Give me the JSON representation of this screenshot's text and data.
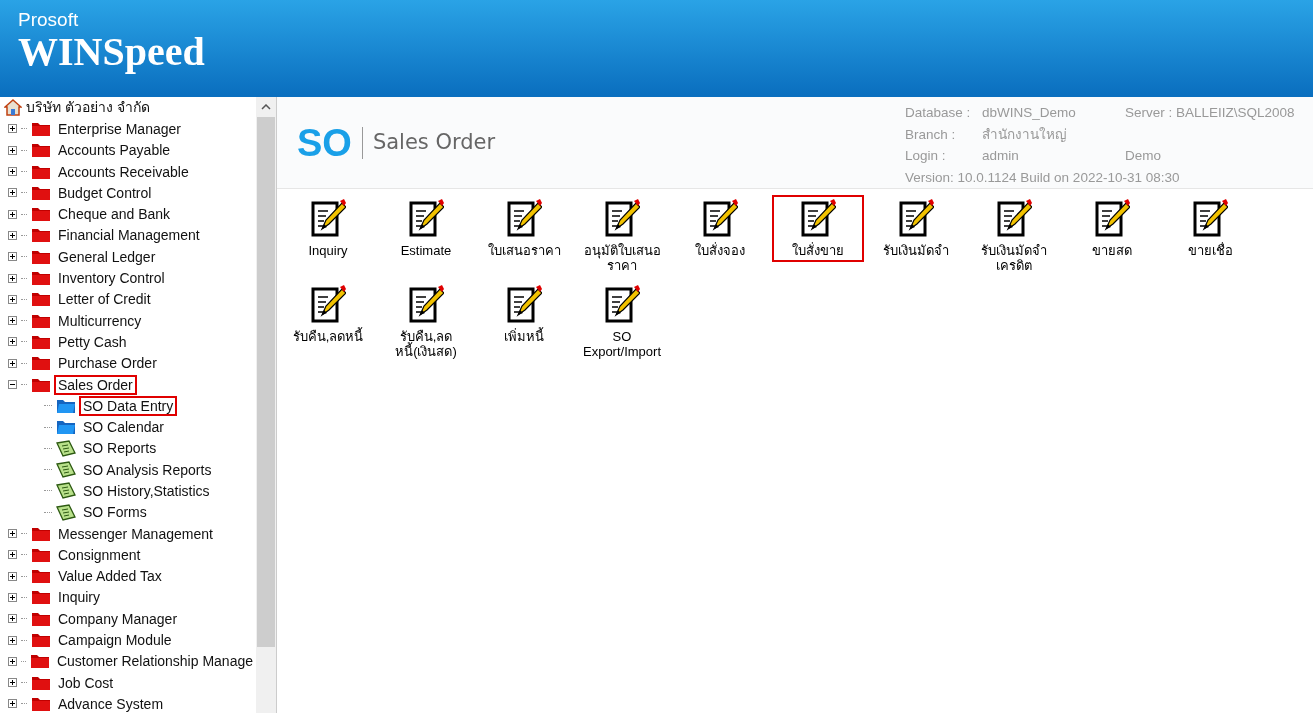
{
  "header": {
    "brand_top": "Prosoft",
    "brand_main": "WINSpeed"
  },
  "tree": {
    "label": "บริษัท ตัวอย่าง จำกัด",
    "children": [
      {
        "label": "Enterprise Manager",
        "kind": "folder",
        "expanded": false,
        "highlighted": false
      },
      {
        "label": "Accounts Payable",
        "kind": "folder",
        "expanded": false,
        "highlighted": false
      },
      {
        "label": "Accounts Receivable",
        "kind": "folder",
        "expanded": false,
        "highlighted": false
      },
      {
        "label": "Budget Control",
        "kind": "folder",
        "expanded": false,
        "highlighted": false
      },
      {
        "label": "Cheque and Bank",
        "kind": "folder",
        "expanded": false,
        "highlighted": false
      },
      {
        "label": "Financial Management",
        "kind": "folder",
        "expanded": false,
        "highlighted": false
      },
      {
        "label": "General Ledger",
        "kind": "folder",
        "expanded": false,
        "highlighted": false
      },
      {
        "label": "Inventory Control",
        "kind": "folder",
        "expanded": false,
        "highlighted": false
      },
      {
        "label": "Letter of Credit",
        "kind": "folder",
        "expanded": false,
        "highlighted": false
      },
      {
        "label": "Multicurrency",
        "kind": "folder",
        "expanded": false,
        "highlighted": false
      },
      {
        "label": "Petty Cash",
        "kind": "folder",
        "expanded": false,
        "highlighted": false
      },
      {
        "label": "Purchase Order",
        "kind": "folder",
        "expanded": false,
        "highlighted": false
      },
      {
        "label": "Sales Order",
        "kind": "folder",
        "expanded": true,
        "highlighted": true,
        "children": [
          {
            "label": "SO Data Entry",
            "kind": "entry",
            "highlighted": true
          },
          {
            "label": "SO Calendar",
            "kind": "entry",
            "highlighted": false
          },
          {
            "label": "SO Reports",
            "kind": "report",
            "highlighted": false
          },
          {
            "label": "SO Analysis Reports",
            "kind": "report",
            "highlighted": false
          },
          {
            "label": "SO History,Statistics",
            "kind": "report",
            "highlighted": false
          },
          {
            "label": "SO Forms",
            "kind": "report",
            "highlighted": false
          }
        ]
      },
      {
        "label": "Messenger Management",
        "kind": "folder",
        "expanded": false,
        "highlighted": false
      },
      {
        "label": "Consignment",
        "kind": "folder",
        "expanded": false,
        "highlighted": false
      },
      {
        "label": "Value Added Tax",
        "kind": "folder",
        "expanded": false,
        "highlighted": false
      },
      {
        "label": "Inquiry",
        "kind": "folder",
        "expanded": false,
        "highlighted": false
      },
      {
        "label": "Company Manager",
        "kind": "folder",
        "expanded": false,
        "highlighted": false
      },
      {
        "label": "Campaign Module",
        "kind": "folder",
        "expanded": false,
        "highlighted": false
      },
      {
        "label": "Customer Relationship Manage",
        "kind": "folder",
        "expanded": false,
        "highlighted": false
      },
      {
        "label": "Job Cost",
        "kind": "folder",
        "expanded": false,
        "highlighted": false
      },
      {
        "label": "Advance System",
        "kind": "folder",
        "expanded": false,
        "highlighted": false
      }
    ]
  },
  "module": {
    "code": "SO",
    "name": "Sales Order",
    "info": [
      {
        "label": "Database :",
        "value": "dbWINS_Demo",
        "extra": "Server : BALLEIIZ\\SQL2008"
      },
      {
        "label": "Branch :",
        "value": "สำนักงานใหญ่"
      },
      {
        "label": "Login :",
        "value": "admin",
        "extra": "Demo"
      }
    ],
    "version": "Version: 10.0.1124  Build on 2022-10-31 08:30"
  },
  "programs": [
    {
      "label": "Inquiry",
      "highlighted": false
    },
    {
      "label": "Estimate",
      "highlighted": false
    },
    {
      "label": "ใบเสนอราคา",
      "highlighted": false
    },
    {
      "label": "อนุมัติใบเสนอราคา",
      "highlighted": false
    },
    {
      "label": "ใบสั่งจอง",
      "highlighted": false
    },
    {
      "label": "ใบสั่งขาย",
      "highlighted": true
    },
    {
      "label": "รับเงินมัดจำ",
      "highlighted": false
    },
    {
      "label": "รับเงินมัดจำเครดิต",
      "highlighted": false
    },
    {
      "label": "ขายสด",
      "highlighted": false
    },
    {
      "label": "ขายเชื่อ",
      "highlighted": false
    },
    {
      "label": "รับคืน,ลดหนี้",
      "highlighted": false
    },
    {
      "label": "รับคืน,ลดหนี้(เงินสด)",
      "highlighted": false
    },
    {
      "label": "เพิ่มหนี้",
      "highlighted": false
    },
    {
      "label": "SO Export/Import",
      "highlighted": false
    }
  ]
}
